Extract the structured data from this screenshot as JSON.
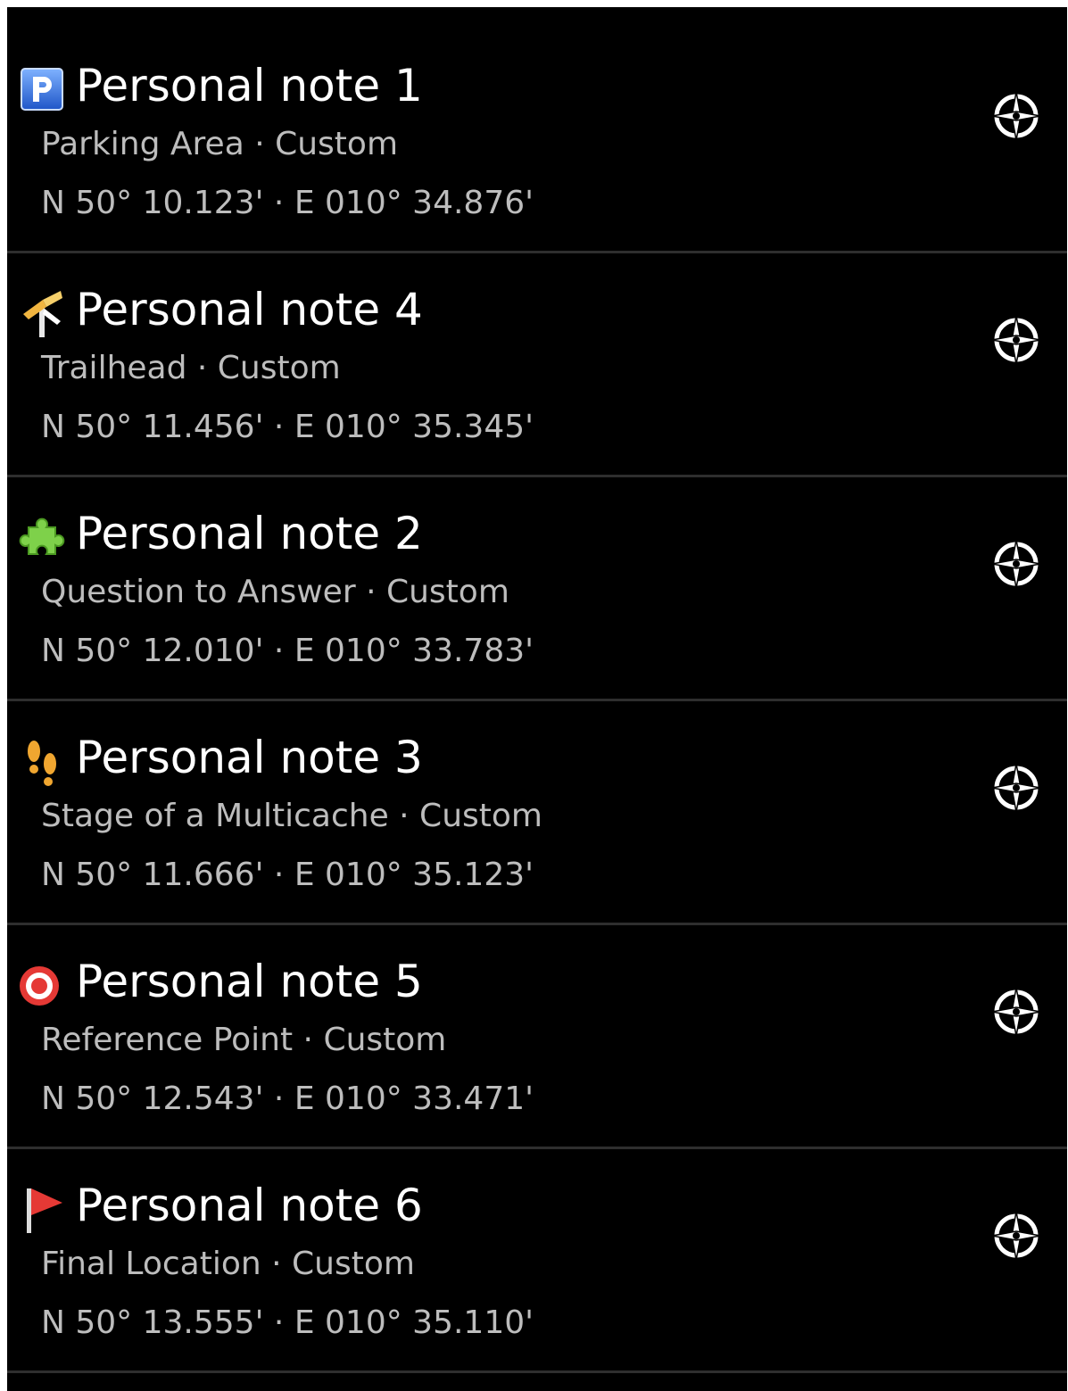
{
  "waypoints": [
    {
      "title": "Personal note 1",
      "subtitle": "Parking Area · Custom",
      "coords": "N 50° 10.123' · E 010° 34.876'",
      "icon": "parking-icon"
    },
    {
      "title": "Personal note 4",
      "subtitle": "Trailhead · Custom",
      "coords": "N 50° 11.456' · E 010° 35.345'",
      "icon": "trailhead-icon"
    },
    {
      "title": "Personal note 2",
      "subtitle": "Question to Answer · Custom",
      "coords": "N 50° 12.010' · E 010° 33.783'",
      "icon": "puzzle-icon"
    },
    {
      "title": "Personal note 3",
      "subtitle": "Stage of a Multicache · Custom",
      "coords": "N 50° 11.666' · E 010° 35.123'",
      "icon": "footprints-icon"
    },
    {
      "title": "Personal note 5",
      "subtitle": "Reference Point · Custom",
      "coords": "N 50° 12.543' · E 010° 33.471'",
      "icon": "target-icon"
    },
    {
      "title": "Personal note 6",
      "subtitle": "Final Location · Custom",
      "coords": "N 50° 13.555' · E 010° 35.110'",
      "icon": "flag-icon"
    }
  ],
  "colors": {
    "background": "#000000",
    "title": "#ffffff",
    "secondary": "#bdbdbd",
    "divider": "#2e2e2e"
  },
  "nav_icon": "compass-navigate-icon"
}
